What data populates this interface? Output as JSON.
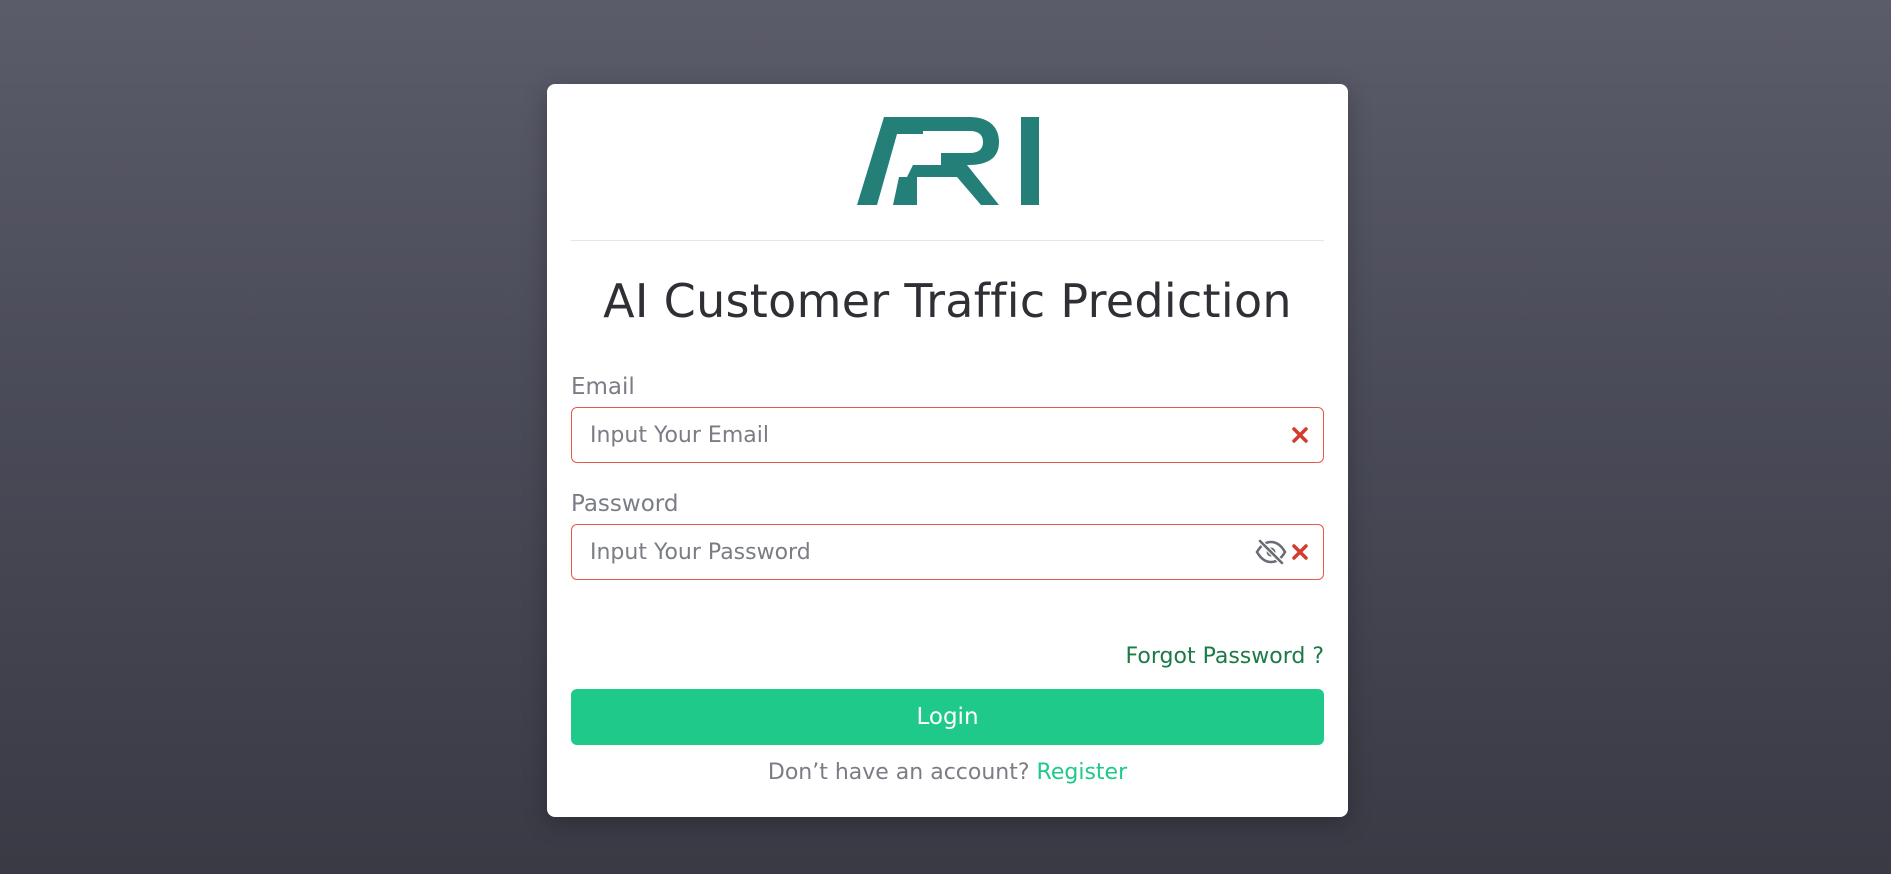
{
  "brand": {
    "logo_text": "ARI",
    "logo_color": "#237f78"
  },
  "page": {
    "title": "AI Customer Traffic Prediction"
  },
  "form": {
    "email": {
      "label": "Email",
      "placeholder": "Input Your Email",
      "value": ""
    },
    "password": {
      "label": "Password",
      "placeholder": "Input Your Password",
      "value": ""
    },
    "error_color": "#e05a4e",
    "forgot_password": "Forgot Password ?",
    "login_button": "Login",
    "no_account_text": "Don’t have an account?",
    "register_link": "Register"
  },
  "colors": {
    "primary": "#1fc98a",
    "forgot_link": "#1b7a45"
  },
  "icons": {
    "clear": "close-icon",
    "visibility": "eye-slash-icon"
  }
}
